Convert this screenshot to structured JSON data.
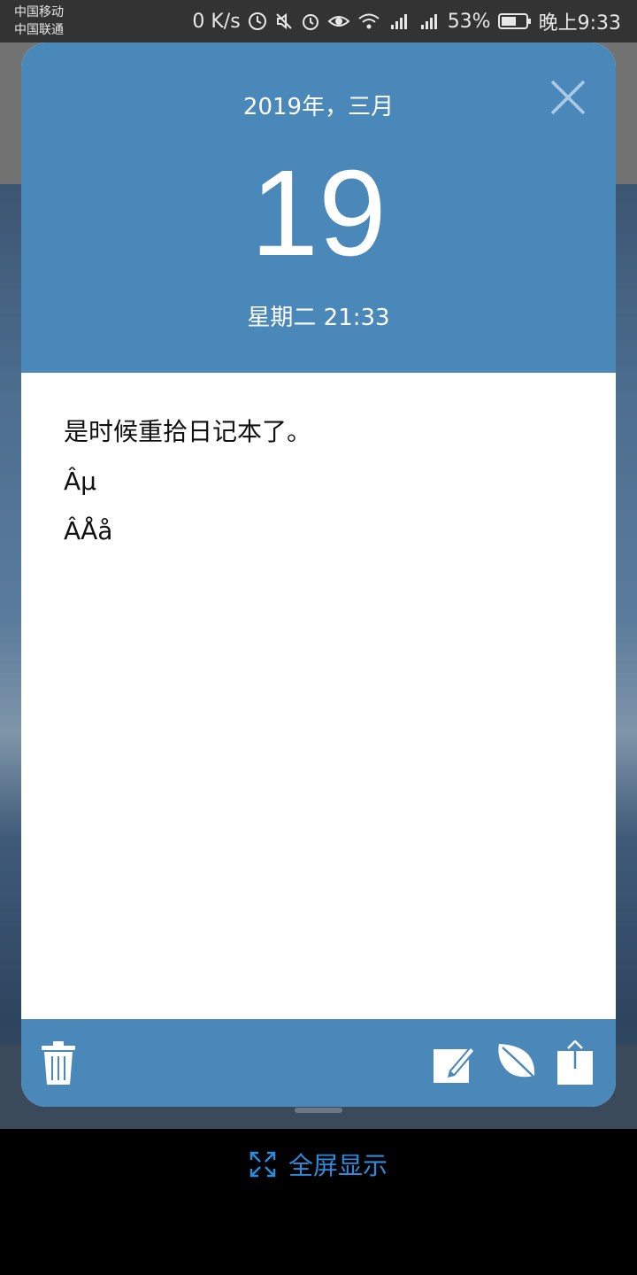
{
  "status_bar": {
    "carrier1": "中国移动",
    "carrier2": "中国联通",
    "net_speed": "0 K/s",
    "battery": "53%",
    "time": "晚上9:33"
  },
  "dialog": {
    "month_year": "2019年，三月",
    "day": "19",
    "weekday_time": "星期二 21:33",
    "content_lines": [
      "是时候重拾日记本了。",
      "Âµ",
      "ÂÅå"
    ]
  },
  "fullscreen": {
    "label": "全屏显示"
  },
  "colors": {
    "header_bg": "#4a88b9",
    "link": "#2b8cde"
  },
  "icons": [
    "close-icon",
    "trash-icon",
    "edit-icon",
    "leaf-icon",
    "share-icon",
    "expand-icon"
  ]
}
